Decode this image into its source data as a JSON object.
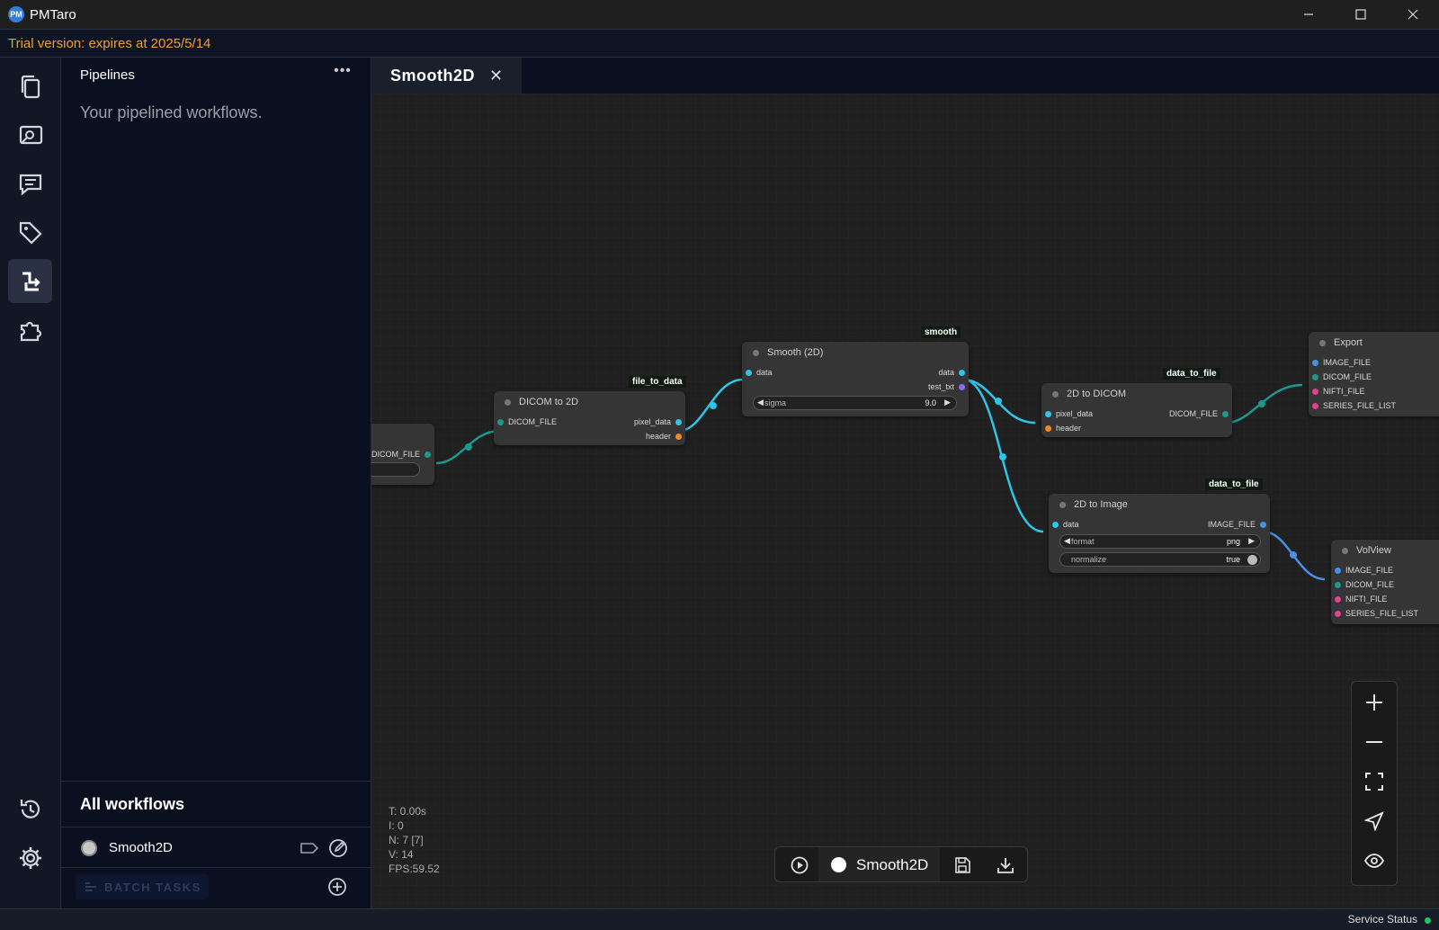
{
  "app": {
    "title": "PMTaro",
    "logo_text": "PM"
  },
  "trial_banner": "Trial version: expires at 2025/5/14",
  "activity_bar": {
    "items": [
      {
        "icon": "files-icon"
      },
      {
        "icon": "viewer-icon"
      },
      {
        "icon": "comments-icon"
      },
      {
        "icon": "tags-icon"
      },
      {
        "icon": "pipeline-icon",
        "active": true
      },
      {
        "icon": "plugin-icon"
      }
    ],
    "bottom": [
      {
        "icon": "history-icon"
      },
      {
        "icon": "gear-icon"
      }
    ]
  },
  "panel": {
    "title": "Pipelines",
    "more": "•••",
    "description": "Your pipelined workflows.",
    "all_workflows": "All workflows",
    "workflows": [
      {
        "name": "Smooth2D"
      }
    ],
    "batch_tasks": "BATCH TASKS"
  },
  "tab": {
    "label": "Smooth2D",
    "close": "✕"
  },
  "graph": {
    "nodes": {
      "source": {
        "out_port": "DICOM_FILE"
      },
      "dicom2d": {
        "title": "DICOM to 2D",
        "label": "file_to_data",
        "in": "DICOM_FILE",
        "out1": "pixel_data",
        "out2": "header"
      },
      "smooth": {
        "title": "Smooth (2D)",
        "label": "smooth",
        "in": "data",
        "out1": "data",
        "out2": "test_txt",
        "widget_label": "sigma",
        "widget_value": "9.0"
      },
      "to_dicom": {
        "title": "2D to DICOM",
        "label": "data_to_file",
        "in1": "pixel_data",
        "in2": "header",
        "out": "DICOM_FILE"
      },
      "to_image": {
        "title": "2D to Image",
        "label": "data_to_file",
        "in": "data",
        "out": "IMAGE_FILE",
        "w1_label": "format",
        "w1_value": "png",
        "w2_label": "normalize",
        "w2_value": "true"
      },
      "export": {
        "title": "Export",
        "ports": [
          "IMAGE_FILE",
          "DICOM_FILE",
          "NIFTI_FILE",
          "SERIES_FILE_LIST"
        ]
      },
      "volview": {
        "title": "VolView",
        "ports": [
          "IMAGE_FILE",
          "DICOM_FILE",
          "NIFTI_FILE",
          "SERIES_FILE_LIST"
        ]
      }
    },
    "stats": {
      "t": "T: 0.00s",
      "i": "I: 0",
      "n": "N: 7 [7]",
      "v": "V: 14",
      "fps": "FPS:59.52"
    },
    "colors": {
      "link_teal": "#1a9a8c",
      "link_cyan": "#2ec5e6",
      "link_blue": "#4a90e2",
      "port_orange": "#f08a24",
      "port_pink": "#e0438f",
      "port_purple": "#8a6cf0"
    }
  },
  "runbar": {
    "workflow": "Smooth2D"
  },
  "status": {
    "label": "Service Status"
  }
}
